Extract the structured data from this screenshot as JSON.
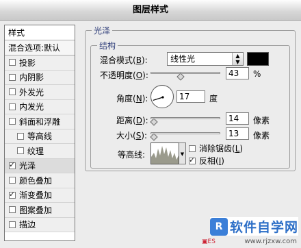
{
  "window": {
    "title": "图层样式"
  },
  "sidebar": {
    "header": "样式",
    "blend_options": "混合选项:默认",
    "items": [
      {
        "label": "投影",
        "checked": false,
        "sub": false
      },
      {
        "label": "内阴影",
        "checked": false,
        "sub": false
      },
      {
        "label": "外发光",
        "checked": false,
        "sub": false
      },
      {
        "label": "内发光",
        "checked": false,
        "sub": false
      },
      {
        "label": "斜面和浮雕",
        "checked": false,
        "sub": false
      },
      {
        "label": "等高线",
        "checked": false,
        "sub": true
      },
      {
        "label": "纹理",
        "checked": false,
        "sub": true
      },
      {
        "label": "光泽",
        "checked": true,
        "sub": false,
        "active": true
      },
      {
        "label": "颜色叠加",
        "checked": false,
        "sub": false
      },
      {
        "label": "渐变叠加",
        "checked": true,
        "sub": false
      },
      {
        "label": "图案叠加",
        "checked": false,
        "sub": false
      },
      {
        "label": "描边",
        "checked": false,
        "sub": false
      }
    ]
  },
  "panel": {
    "group_title": "光泽",
    "structure_title": "结构",
    "blend_mode": {
      "label_prefix": "混合模式",
      "label_hotkey": "B",
      "value": "线性光",
      "color": "#000000"
    },
    "opacity": {
      "label_prefix": "不透明度",
      "label_hotkey": "O",
      "value": "43",
      "unit": "%",
      "percent": 43
    },
    "angle": {
      "label_prefix": "角度",
      "label_hotkey": "N",
      "value": "17",
      "unit": "度",
      "degrees": 17
    },
    "distance": {
      "label_prefix": "距离",
      "label_hotkey": "D",
      "value": "14",
      "unit": "像素",
      "percent": 5
    },
    "size": {
      "label_prefix": "大小",
      "label_hotkey": "S",
      "value": "13",
      "unit": "像素",
      "percent": 5
    },
    "contour": {
      "label": "等高线:"
    },
    "anti_alias": {
      "label_prefix": "消除锯齿",
      "label_hotkey": "L",
      "checked": false
    },
    "invert": {
      "label_prefix": "反相",
      "label_hotkey": "I",
      "checked": true
    }
  },
  "watermark": {
    "brand": "软件自学网",
    "logo_text": "R",
    "url": "www.rjzxw.com"
  }
}
